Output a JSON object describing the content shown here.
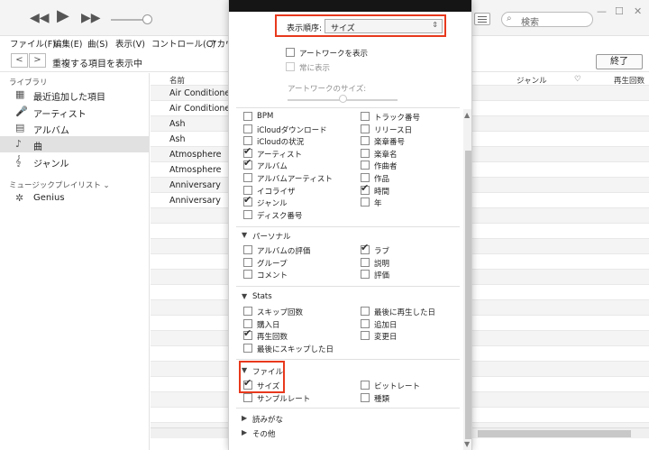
{
  "toolbar": {
    "prev_icon": "◀◀",
    "play_icon": "▶",
    "next_icon": "▶▶",
    "search_placeholder": "検索",
    "minimize": "—",
    "maximize": "☐",
    "close": "✕"
  },
  "menu": [
    "ファイル(F)",
    "編集(E)",
    "曲(S)",
    "表示(V)",
    "コントロール(C)",
    "アカウ"
  ],
  "nav": {
    "back": "<",
    "forward": ">",
    "title": "重複する項目を表示中",
    "done": "終了"
  },
  "sidebar": {
    "library_heading": "ライブラリ",
    "items": [
      {
        "label": "最近追加した項目",
        "icon": "▦",
        "selected": false
      },
      {
        "label": "アーティスト",
        "icon": "🎤",
        "selected": false
      },
      {
        "label": "アルバム",
        "icon": "▤",
        "selected": false
      },
      {
        "label": "曲",
        "icon": "♪",
        "selected": true
      },
      {
        "label": "ジャンル",
        "icon": "𝄞",
        "selected": false
      }
    ],
    "playlist_heading": "ミュージックプレイリスト ⌄",
    "genius": {
      "label": "Genius",
      "icon": "✲"
    }
  },
  "songlist": {
    "columns": {
      "name": "名前",
      "genre": "ジャンル",
      "heart": "♡",
      "plays": "再生回数"
    },
    "rows": [
      "Air Conditioner",
      "Air Conditioner",
      "Ash",
      "Ash",
      "Atmosphere",
      "Atmosphere",
      "Anniversary",
      "Anniversary"
    ]
  },
  "panel": {
    "sort_label": "表示順序:",
    "sort_value": "サイズ",
    "show_artwork": "アートワークを表示",
    "always_show": "常に表示",
    "artwork_size": "アートワークのサイズ:",
    "top_left": [
      {
        "label": "BPM",
        "checked": false
      },
      {
        "label": "iCloudダウンロード",
        "checked": false
      },
      {
        "label": "iCloudの状況",
        "checked": false
      },
      {
        "label": "アーティスト",
        "checked": true
      },
      {
        "label": "アルバム",
        "checked": true
      },
      {
        "label": "アルバムアーティスト",
        "checked": false
      },
      {
        "label": "イコライザ",
        "checked": false
      },
      {
        "label": "ジャンル",
        "checked": true
      },
      {
        "label": "ディスク番号",
        "checked": false
      }
    ],
    "top_right": [
      {
        "label": "トラック番号",
        "checked": false
      },
      {
        "label": "リリース日",
        "checked": false
      },
      {
        "label": "楽章番号",
        "checked": false
      },
      {
        "label": "楽章名",
        "checked": false
      },
      {
        "label": "作曲者",
        "checked": false
      },
      {
        "label": "作品",
        "checked": false
      },
      {
        "label": "時間",
        "checked": true
      },
      {
        "label": "年",
        "checked": false
      }
    ],
    "personal": {
      "title": "パーソナル",
      "left": [
        {
          "label": "アルバムの評価",
          "checked": false
        },
        {
          "label": "グループ",
          "checked": false
        },
        {
          "label": "コメント",
          "checked": false
        }
      ],
      "right": [
        {
          "label": "ラブ",
          "checked": true
        },
        {
          "label": "説明",
          "checked": false
        },
        {
          "label": "評価",
          "checked": false
        }
      ]
    },
    "stats": {
      "title": "Stats",
      "left": [
        {
          "label": "スキップ回数",
          "checked": false
        },
        {
          "label": "購入日",
          "checked": false
        },
        {
          "label": "再生回数",
          "checked": true
        },
        {
          "label": "最後にスキップした日",
          "checked": false
        }
      ],
      "right": [
        {
          "label": "最後に再生した日",
          "checked": false
        },
        {
          "label": "追加日",
          "checked": false
        },
        {
          "label": "変更日",
          "checked": false
        }
      ]
    },
    "file": {
      "title": "ファイル",
      "left": [
        {
          "label": "サイズ",
          "checked": true
        },
        {
          "label": "サンプルレート",
          "checked": false
        }
      ],
      "right": [
        {
          "label": "ビットレート",
          "checked": false
        },
        {
          "label": "種類",
          "checked": false
        }
      ]
    },
    "collapsed": [
      "読みがな",
      "その他"
    ],
    "tri_open": "▼",
    "tri_closed": "▶",
    "check_mark": "✔"
  },
  "colors": {
    "highlight": "#e8391d",
    "selected_row": "#e1e1e1"
  }
}
